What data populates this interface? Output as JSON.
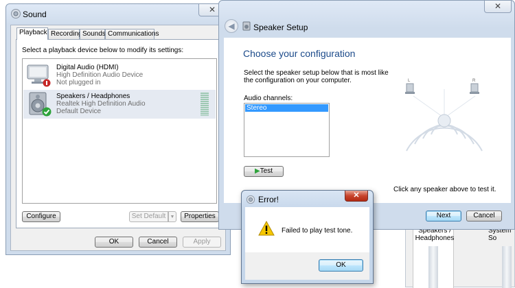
{
  "sound": {
    "title": "Sound",
    "tabs": [
      {
        "label": "Playback"
      },
      {
        "label": "Recording"
      },
      {
        "label": "Sounds"
      },
      {
        "label": "Communications"
      }
    ],
    "instruction": "Select a playback device below to modify its settings:",
    "devices": [
      {
        "name": "Digital Audio (HDMI)",
        "line2": "High Definition Audio Device",
        "line3": "Not plugged in",
        "icon": "monitor-icon",
        "status": "unplugged"
      },
      {
        "name": "Speakers / Headphones",
        "line2": "Realtek High Definition Audio",
        "line3": "Default Device",
        "icon": "speaker-icon",
        "status": "default"
      }
    ],
    "buttons": {
      "configure": "Configure",
      "set_default": "Set Default",
      "properties": "Properties",
      "ok": "OK",
      "cancel": "Cancel",
      "apply": "Apply"
    },
    "close_glyph": "✕"
  },
  "speaker_setup": {
    "title": "Speaker Setup",
    "heading": "Choose your configuration",
    "description_line1": "Select the speaker setup below that is most like",
    "description_line2": "the configuration on your computer.",
    "channels_label": "Audio channels:",
    "channels": [
      "Stereo"
    ],
    "selected_channel": "Stereo",
    "test_button": "Test",
    "hint": "Click any speaker above to test it.",
    "next_button": "Next",
    "cancel_button": "Cancel",
    "speaker_labels": {
      "left": "L",
      "right": "R"
    },
    "close_glyph": "✕"
  },
  "error": {
    "title": "Error!",
    "message": "Failed to play test tone.",
    "ok_button": "OK",
    "close_glyph": "✕"
  },
  "background_window": {
    "item1_line1": "Speakers /",
    "item1_line2": "Headphones",
    "item2": "System So"
  },
  "colors": {
    "heading_blue": "#1b4a8a",
    "selection_blue": "#3399ff",
    "warning_yellow": "#f6c700",
    "ok_green": "#2ea33b",
    "error_red": "#c8442e"
  }
}
